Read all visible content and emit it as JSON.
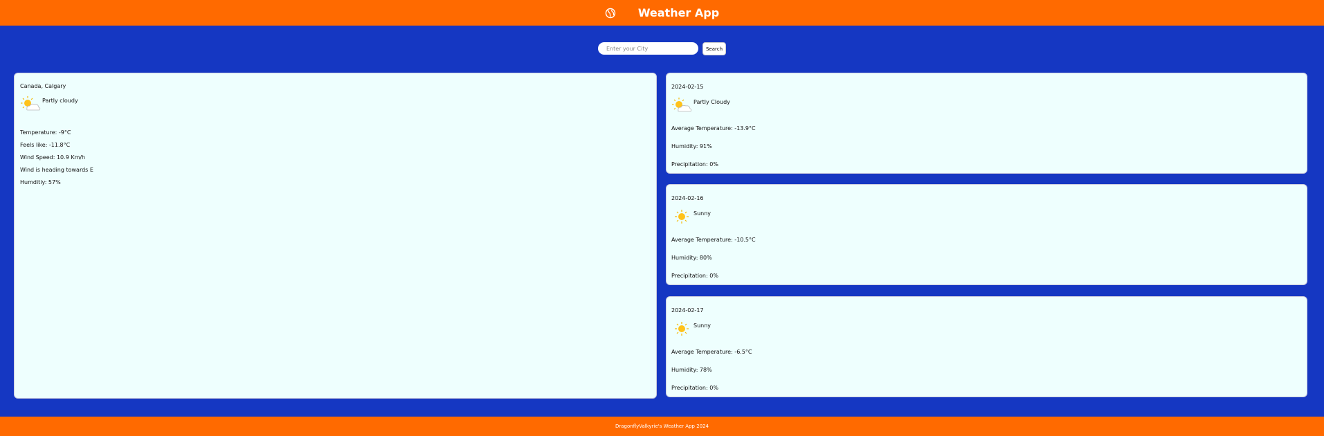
{
  "header": {
    "title": "Weather App",
    "icon": "globe-icon"
  },
  "search": {
    "placeholder": "Enter your City",
    "value": "",
    "button_label": "Search"
  },
  "current": {
    "location": "Canada, Calgary",
    "condition": "Partly cloudy",
    "condition_icon": "partly-cloudy-icon",
    "temperature": "Temperature: -9°C",
    "feels_like": "Feels like: -11.8°C",
    "wind_speed": "Wind Speed: 10.9 Km/h",
    "wind_direction": "Wind is heading towards E",
    "humidity": "Humditiy: 57%"
  },
  "forecast": [
    {
      "date": "2024-02-15",
      "condition": "Partly Cloudy",
      "condition_icon": "partly-cloudy-icon",
      "avg_temp": "Average Temperature: -13.9°C",
      "humidity": "Humidity: 91%",
      "precipitation": "Precipitation: 0%"
    },
    {
      "date": "2024-02-16",
      "condition": "Sunny",
      "condition_icon": "sun-icon",
      "avg_temp": "Average Temperature: -10.5°C",
      "humidity": "Humidity: 80%",
      "precipitation": "Precipitation: 0%"
    },
    {
      "date": "2024-02-17",
      "condition": "Sunny",
      "condition_icon": "sun-icon",
      "avg_temp": "Average Temperature: -6.5°C",
      "humidity": "Humidity: 78%",
      "precipitation": "Precipitation: 0%"
    }
  ],
  "footer": {
    "text": "DragonflyValkyrie's Weather App 2024"
  },
  "colors": {
    "header_bg": "#ff6a00",
    "page_bg": "#1537c2",
    "card_bg": "#eefffe"
  }
}
